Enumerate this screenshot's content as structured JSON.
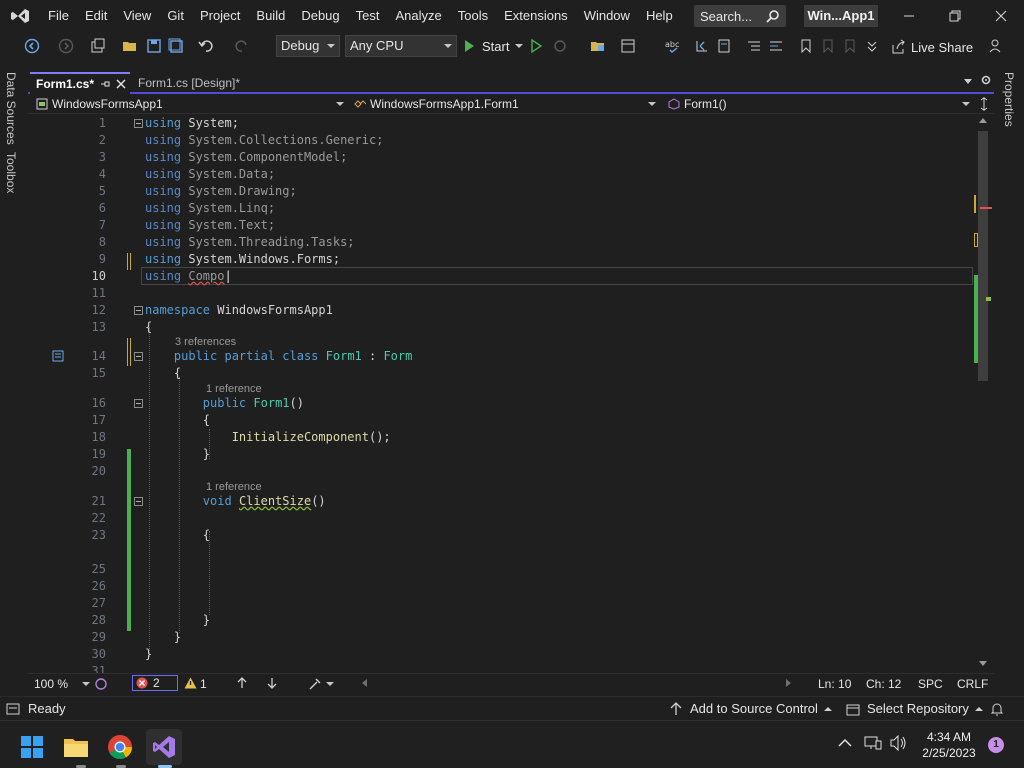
{
  "menu": [
    "File",
    "Edit",
    "View",
    "Git",
    "Project",
    "Build",
    "Debug",
    "Test",
    "Analyze",
    "Tools",
    "Extensions",
    "Window",
    "Help"
  ],
  "search": {
    "placeholder": "Search..."
  },
  "solution_title": "Win...App1",
  "toolbar": {
    "config": "Debug",
    "platform": "Any CPU",
    "start_label": "Start",
    "live_share": "Live Share"
  },
  "side_tabs": {
    "left": [
      "Data Sources",
      "Toolbox"
    ],
    "right": [
      "Properties"
    ]
  },
  "tabs": [
    {
      "label": "Form1.cs*",
      "active": true
    },
    {
      "label": "Form1.cs [Design]*",
      "active": false
    }
  ],
  "nav": {
    "project": "WindowsFormsApp1",
    "type": "WindowsFormsApp1.Form1",
    "member": "Form1()"
  },
  "code_lines": [
    {
      "n": "1",
      "text": "using System;"
    },
    {
      "n": "2",
      "text": "using System.Collections.Generic;"
    },
    {
      "n": "3",
      "text": "using System.ComponentModel;"
    },
    {
      "n": "4",
      "text": "using System.Data;"
    },
    {
      "n": "5",
      "text": "using System.Drawing;"
    },
    {
      "n": "6",
      "text": "using System.Linq;"
    },
    {
      "n": "7",
      "text": "using System.Text;"
    },
    {
      "n": "8",
      "text": "using System.Threading.Tasks;"
    },
    {
      "n": "9",
      "text": "using System.Windows.Forms;"
    },
    {
      "n": "10",
      "text": "using Compo"
    },
    {
      "n": "11",
      "text": ""
    },
    {
      "n": "12",
      "text": "namespace WindowsFormsApp1"
    },
    {
      "n": "13",
      "text": "{"
    },
    {
      "n": "14",
      "text": "public partial class Form1 : Form"
    },
    {
      "n": "15",
      "text": "{"
    },
    {
      "n": "16",
      "text": "public Form1()"
    },
    {
      "n": "17",
      "text": "{"
    },
    {
      "n": "18",
      "text": "InitializeComponent();"
    },
    {
      "n": "19",
      "text": "}"
    },
    {
      "n": "20",
      "text": ""
    },
    {
      "n": "21",
      "text": "void ClientSize()"
    },
    {
      "n": "22",
      "text": ""
    },
    {
      "n": "23",
      "text": "{"
    },
    {
      "n": "25",
      "text": ""
    },
    {
      "n": "26",
      "text": ""
    },
    {
      "n": "27",
      "text": ""
    },
    {
      "n": "28",
      "text": "}"
    },
    {
      "n": "29",
      "text": "}"
    },
    {
      "n": "30",
      "text": "}"
    },
    {
      "n": "31",
      "text": ""
    }
  ],
  "code_lens": {
    "class_refs": "3 references",
    "ctor_refs": "1 reference",
    "method_refs": "1 reference"
  },
  "editor_status": {
    "zoom": "100 %",
    "errors": "2",
    "warnings": "1",
    "line": "Ln: 10",
    "col": "Ch: 12",
    "whitespace": "SPC",
    "line_ending": "CRLF"
  },
  "statusbar": {
    "ready": "Ready",
    "source_control": "Add to Source Control",
    "repository": "Select Repository"
  },
  "taskbar": {
    "time": "4:34 AM",
    "date": "2/25/2023",
    "notifications": "1"
  },
  "colors": {
    "accent": "#7e7efc",
    "keyword": "#569cd6",
    "class": "#4ec9b0",
    "method": "#dcdcaa",
    "change_saved": "#4caf50",
    "change_unsaved": "#c8a93a"
  }
}
